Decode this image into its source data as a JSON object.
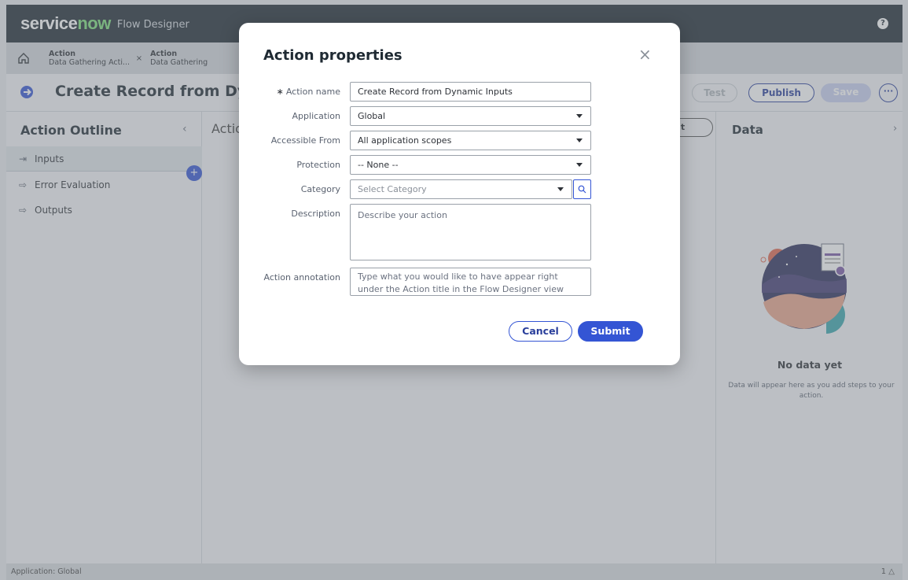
{
  "banner": {
    "brand_service": "service",
    "brand_now": "now",
    "product": "Flow Designer",
    "help": "?"
  },
  "tabs": [
    {
      "type": "Action",
      "name": "Data Gathering Acti...",
      "close": "×"
    },
    {
      "type": "Action",
      "name": "Data Gathering"
    }
  ],
  "header": {
    "title": "Create Record from Dyna",
    "test_label": "Test",
    "publish_label": "Publish",
    "save_label": "Save",
    "more_label": "···"
  },
  "outline": {
    "title": "Action Outline",
    "collapse": "‹",
    "items": [
      {
        "label": "Inputs",
        "icon": "input-icon"
      },
      {
        "label": "Error Evaluation",
        "icon": "output-icon"
      },
      {
        "label": "Outputs",
        "icon": "output-icon"
      }
    ],
    "add_badge": "+"
  },
  "center": {
    "title": "Actio",
    "right_fragment": "ut"
  },
  "data_panel": {
    "title": "Data",
    "expand": "›",
    "empty_title": "No data yet",
    "empty_text": "Data will appear here as you add steps to your action."
  },
  "status": {
    "left": "Application: Global",
    "right": "1"
  },
  "modal": {
    "title": "Action properties",
    "close": "×",
    "fields": {
      "action_name": {
        "label": "Action name",
        "value": "Create Record from Dynamic Inputs",
        "required": "∗"
      },
      "application": {
        "label": "Application",
        "value": "Global"
      },
      "accessible_from": {
        "label": "Accessible From",
        "value": "All application scopes"
      },
      "protection": {
        "label": "Protection",
        "value": "-- None --"
      },
      "category": {
        "label": "Category",
        "placeholder": "Select Category"
      },
      "description": {
        "label": "Description",
        "placeholder": "Describe your action"
      },
      "annotation": {
        "label": "Action annotation",
        "placeholder": "Type what you would like to have appear right under the Action title in the Flow Designer view"
      }
    },
    "cancel_label": "Cancel",
    "submit_label": "Submit"
  },
  "colors": {
    "accent": "#3455d4",
    "publish": "#293e9b",
    "banner": "#1f2a33",
    "brand_green": "#7ee07c"
  }
}
